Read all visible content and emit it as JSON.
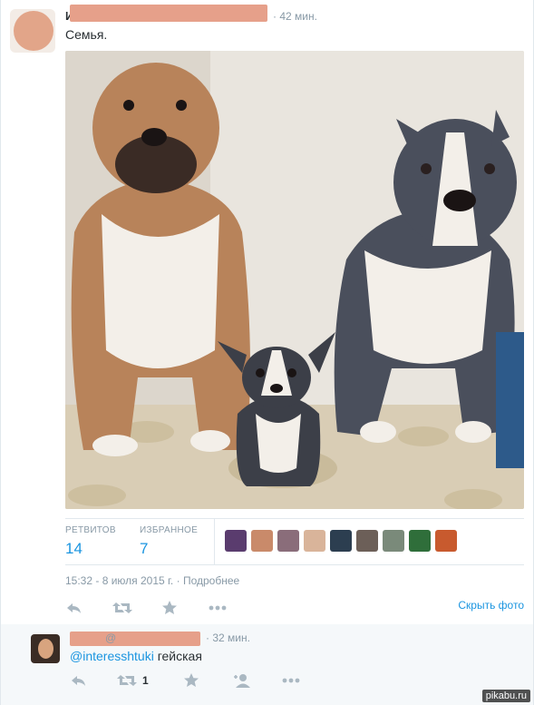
{
  "tweet": {
    "author_initial": "И",
    "time": "· 42 мин.",
    "text": "Семья.",
    "stats": {
      "retweets_label": "РЕТВИТОВ",
      "retweets_value": "14",
      "favorites_label": "ИЗБРАННОЕ",
      "favorites_value": "7"
    },
    "favoriter_avatar_colors": [
      "#5a3c6e",
      "#c98a6a",
      "#8a6d7a",
      "#d9b49a",
      "#2c3e50",
      "#6c5f58",
      "#7a8a7a",
      "#2f6e3a",
      "#c85a2e"
    ],
    "date": "15:32 - 8 июля 2015 г.",
    "more_link": "Подробнее",
    "collapse_link": "Скрыть фото",
    "icons": [
      "reply-icon",
      "retweet-icon",
      "favorite-icon",
      "more-icon"
    ]
  },
  "reply": {
    "at_sign": "@",
    "time": "· 32 мин.",
    "mention": "@interesshtuki",
    "text": " гейская",
    "retweet_count": "1",
    "icons": [
      "reply-icon",
      "retweet-icon",
      "favorite-icon",
      "follow-icon",
      "more-icon"
    ]
  },
  "watermark": "pikabu.ru"
}
